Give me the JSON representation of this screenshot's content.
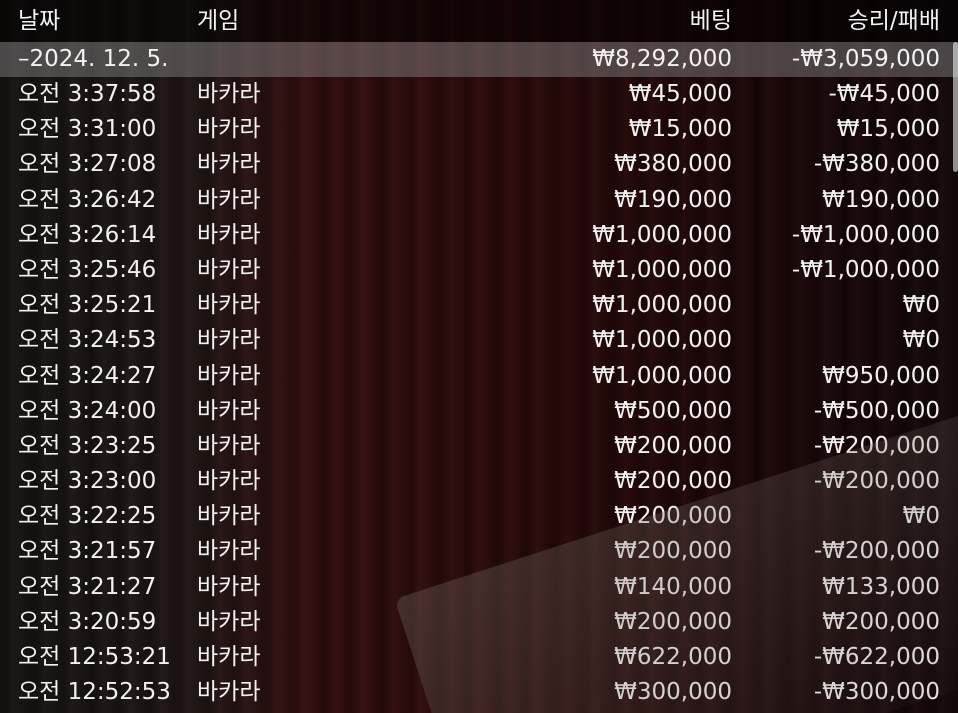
{
  "header": {
    "date": "날짜",
    "game": "게임",
    "bet": "베팅",
    "result": "승리/패배"
  },
  "summary": {
    "date": "–2024. 12. 5.",
    "bet": "₩8,292,000",
    "result": "-₩3,059,000"
  },
  "rows": [
    {
      "time": "오전 3:37:58",
      "game": "바카라",
      "bet": "₩45,000",
      "result": "-₩45,000"
    },
    {
      "time": "오전 3:31:00",
      "game": "바카라",
      "bet": "₩15,000",
      "result": "₩15,000"
    },
    {
      "time": "오전 3:27:08",
      "game": "바카라",
      "bet": "₩380,000",
      "result": "-₩380,000"
    },
    {
      "time": "오전 3:26:42",
      "game": "바카라",
      "bet": "₩190,000",
      "result": "₩190,000"
    },
    {
      "time": "오전 3:26:14",
      "game": "바카라",
      "bet": "₩1,000,000",
      "result": "-₩1,000,000"
    },
    {
      "time": "오전 3:25:46",
      "game": "바카라",
      "bet": "₩1,000,000",
      "result": "-₩1,000,000"
    },
    {
      "time": "오전 3:25:21",
      "game": "바카라",
      "bet": "₩1,000,000",
      "result": "₩0"
    },
    {
      "time": "오전 3:24:53",
      "game": "바카라",
      "bet": "₩1,000,000",
      "result": "₩0"
    },
    {
      "time": "오전 3:24:27",
      "game": "바카라",
      "bet": "₩1,000,000",
      "result": "₩950,000"
    },
    {
      "time": "오전 3:24:00",
      "game": "바카라",
      "bet": "₩500,000",
      "result": "-₩500,000"
    },
    {
      "time": "오전 3:23:25",
      "game": "바카라",
      "bet": "₩200,000",
      "result": "-₩200,000"
    },
    {
      "time": "오전 3:23:00",
      "game": "바카라",
      "bet": "₩200,000",
      "result": "-₩200,000"
    },
    {
      "time": "오전 3:22:25",
      "game": "바카라",
      "bet": "₩200,000",
      "result": "₩0"
    },
    {
      "time": "오전 3:21:57",
      "game": "바카라",
      "bet": "₩200,000",
      "result": "-₩200,000"
    },
    {
      "time": "오전 3:21:27",
      "game": "바카라",
      "bet": "₩140,000",
      "result": "₩133,000"
    },
    {
      "time": "오전 3:20:59",
      "game": "바카라",
      "bet": "₩200,000",
      "result": "₩200,000"
    },
    {
      "time": "오전 12:53:21",
      "game": "바카라",
      "bet": "₩622,000",
      "result": "-₩622,000"
    },
    {
      "time": "오전 12:52:53",
      "game": "바카라",
      "bet": "₩300,000",
      "result": "-₩300,000"
    }
  ]
}
